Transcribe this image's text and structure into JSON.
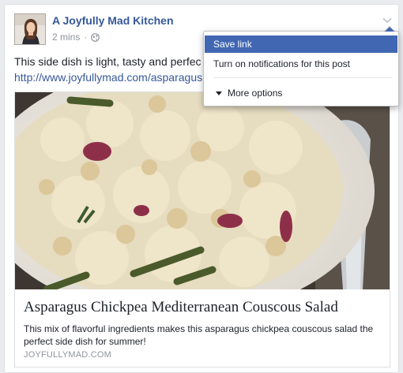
{
  "post": {
    "page_name": "A Joyfully Mad Kitchen",
    "timestamp": "2 mins",
    "separator": "·",
    "audience_icon": "globe-icon",
    "text": "This side dish is light, tasty and perfec",
    "link_text": "http://www.joyfullymad.com/asparagus"
  },
  "attachment": {
    "title": "Asparagus Chickpea Mediterranean Couscous Salad",
    "description": "This mix of flavorful ingredients makes this asparagus chickpea couscous salad the perfect side dish for summer!",
    "domain": "JOYFULLYMAD.COM"
  },
  "menu": {
    "items": [
      {
        "label": "Save link",
        "highlighted": true
      },
      {
        "label": "Turn on notifications for this post",
        "highlighted": false
      },
      {
        "label": "More options",
        "highlighted": false
      }
    ]
  },
  "colors": {
    "link_blue": "#365899",
    "menu_highlight": "#4267b2",
    "muted_text": "#90949c",
    "body_text": "#1d2129"
  }
}
